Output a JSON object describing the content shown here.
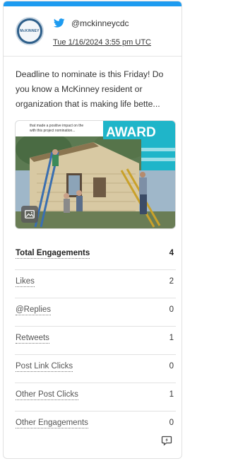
{
  "post": {
    "handle": "@mckinneycdc",
    "timestamp": "Tue 1/16/2024 3:55 pm UTC",
    "text": "Deadline to nominate is this Friday! Do you know a McKinney resident or organization that is making life bette...",
    "avatar_text": "McKINNEY",
    "media_caption_line1": "that made a positive impact on the",
    "media_caption_line2": "with this project nomination...",
    "media_banner_text": "AWARD"
  },
  "stats": [
    {
      "label": "Total Engagements",
      "value": "4"
    },
    {
      "label": "Likes",
      "value": "2"
    },
    {
      "label": "@Replies",
      "value": "0"
    },
    {
      "label": "Retweets",
      "value": "1"
    },
    {
      "label": "Post Link Clicks",
      "value": "0"
    },
    {
      "label": "Other Post Clicks",
      "value": "1"
    },
    {
      "label": "Other Engagements",
      "value": "0"
    }
  ],
  "colors": {
    "accent": "#1d9bf0",
    "banner": "#1fb5c9"
  },
  "icons": {
    "network": "twitter-bird-icon",
    "media": "image-icon",
    "action": "quick-reply-icon"
  }
}
